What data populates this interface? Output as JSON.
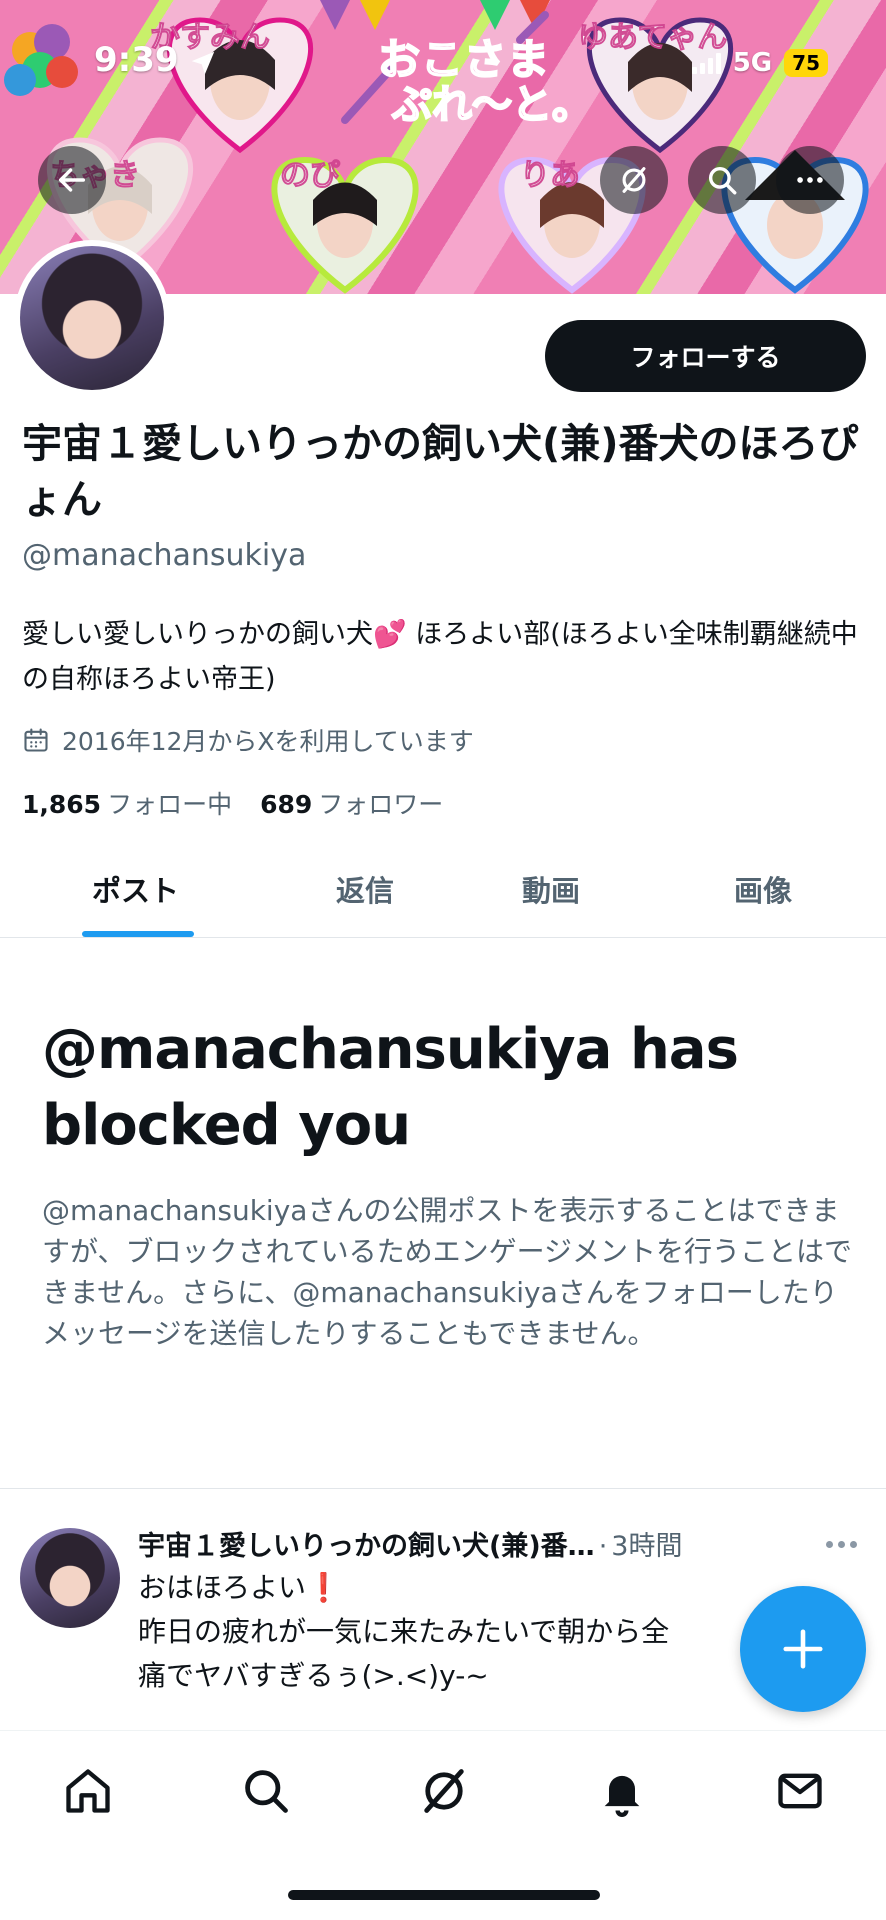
{
  "status_bar": {
    "time": "9:39",
    "network": "5G",
    "battery": "75"
  },
  "banner": {
    "title_line1": "おこさま",
    "title_line2": "ぷれ〜と。",
    "heart_names": [
      "かすみん",
      "ゆあてゃん",
      "ちゃき",
      "のぴ",
      "りあ"
    ]
  },
  "profile": {
    "follow_label": "フォローする",
    "display_name": "宇宙１愛しいりっかの飼い犬(兼)番犬のほろぴょん",
    "handle": "@manachansukiya",
    "bio_part1": "愛しい愛しいりっかの飼い犬",
    "bio_emoji": "💕",
    "bio_part2": " ほろよい部(ほろよい全味制覇継続中の自称ほろよい帝王)",
    "joined": "2016年12月からXを利用しています",
    "following_count": "1,865",
    "following_label": "フォロー中",
    "followers_count": "689",
    "followers_label": "フォロワー"
  },
  "tabs": [
    {
      "label": "ポスト",
      "active": true
    },
    {
      "label": "返信",
      "active": false
    },
    {
      "label": "動画",
      "active": false
    },
    {
      "label": "画像",
      "active": false
    }
  ],
  "blocked": {
    "title": "@manachansukiya has blocked you",
    "body": "@manachansukiyaさんの公開ポストを表示することはできますが、ブロックされているためエンゲージメントを行うことはできません。さらに、@manachansukiyaさんをフォローしたりメッセージを送信したりすることもできません。"
  },
  "post": {
    "author": "宇宙１愛しいりっかの飼い犬(兼)番…",
    "dot": "·",
    "time": "3時間",
    "line1": "おはほろよい",
    "line1_emoji": "❗",
    "line2": "昨日の疲れが一気に来たみたいで朝から全",
    "line3": "痛でヤバすぎるぅ(>.<)y-~"
  },
  "bottom_nav": [
    "home-icon",
    "search-icon",
    "grok-icon",
    "notifications-icon",
    "messages-icon"
  ],
  "colors": {
    "accent": "#1d9bf0",
    "text": "#0f1419",
    "secondary": "#536471",
    "banner_pink": "#f07fb4"
  }
}
